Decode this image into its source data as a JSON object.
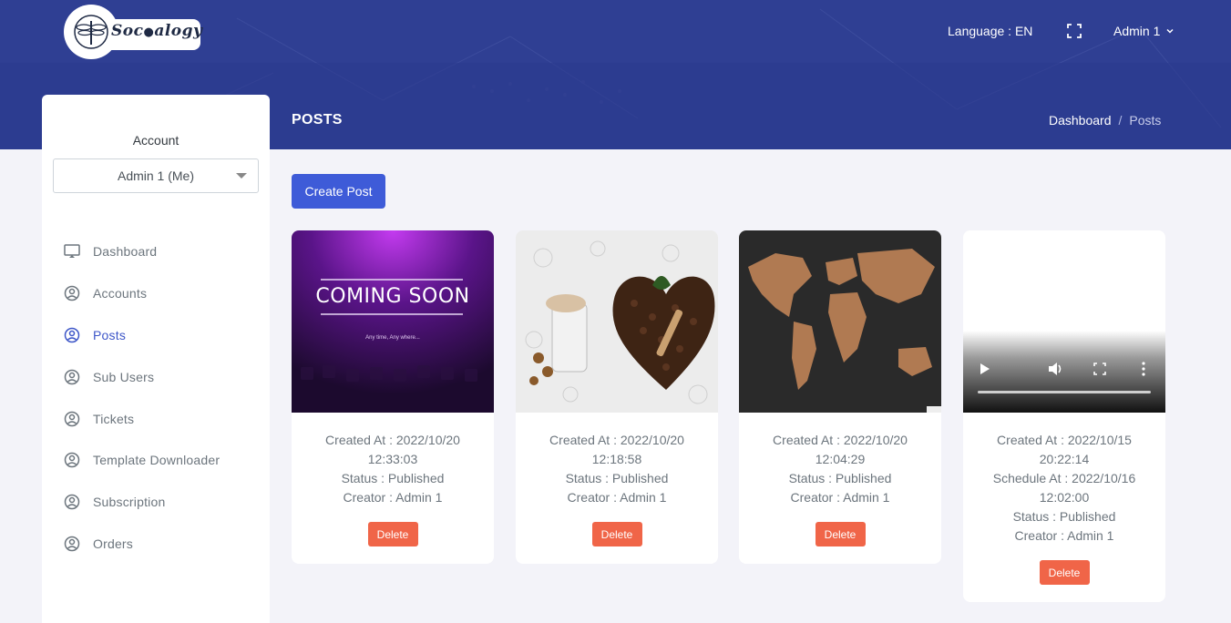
{
  "brand": {
    "logo_text": "Soc??alogy",
    "logo_icon": "dragonfly-icon"
  },
  "header": {
    "language": "Language : EN",
    "fullscreen_icon": "fullscreen-icon",
    "user": "Admin 1",
    "user_icon": "chevron-down-icon"
  },
  "page": {
    "title": "POSTS",
    "breadcrumb": {
      "parent": "Dashboard",
      "separator": "/",
      "current": "Posts"
    }
  },
  "sidebar": {
    "account_label": "Account",
    "account_value": "Admin 1 (Me)",
    "items": [
      {
        "label": "Dashboard",
        "icon": "monitor-icon",
        "active": false
      },
      {
        "label": "Accounts",
        "icon": "user-circle-icon",
        "active": false
      },
      {
        "label": "Posts",
        "icon": "user-circle-icon",
        "active": true
      },
      {
        "label": "Sub Users",
        "icon": "user-circle-icon",
        "active": false
      },
      {
        "label": "Tickets",
        "icon": "user-circle-icon",
        "active": false
      },
      {
        "label": "Template Downloader",
        "icon": "user-circle-icon",
        "active": false
      },
      {
        "label": "Subscription",
        "icon": "user-circle-icon",
        "active": false
      },
      {
        "label": "Orders",
        "icon": "user-circle-icon",
        "active": false
      }
    ]
  },
  "actions": {
    "create_post": "Create Post"
  },
  "posts": [
    {
      "media": "image",
      "image_text": "COMING SOON",
      "image_subtext": "Any time, Any where...",
      "created_date": "Created At : 2022/10/20",
      "created_time": "12:33:03",
      "status": "Status : Published",
      "creator": "Creator : Admin 1",
      "delete": "Delete"
    },
    {
      "media": "image",
      "created_date": "Created At : 2022/10/20",
      "created_time": "12:18:58",
      "status": "Status : Published",
      "creator": "Creator : Admin 1",
      "delete": "Delete"
    },
    {
      "media": "image",
      "created_date": "Created At : 2022/10/20",
      "created_time": "12:04:29",
      "status": "Status : Published",
      "creator": "Creator : Admin 1",
      "delete": "Delete"
    },
    {
      "media": "video",
      "created_date": "Created At : 2022/10/15",
      "created_time": "20:22:14",
      "schedule_date": "Schedule At : 2022/10/16",
      "schedule_time": "12:02:00",
      "status": "Status : Published",
      "creator": "Creator : Admin 1",
      "delete": "Delete"
    }
  ],
  "colors": {
    "header": "#2f3f93",
    "primary": "#3e5bd8",
    "danger": "#f06548",
    "active_nav": "#3d56c8"
  }
}
